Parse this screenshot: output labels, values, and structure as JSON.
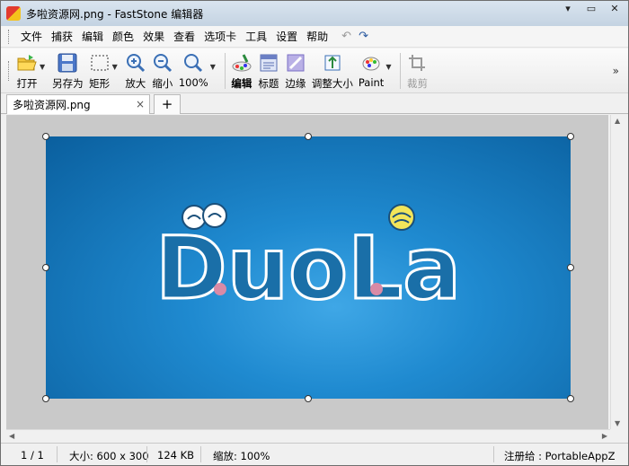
{
  "window": {
    "title": "多啦资源网.png - FastStone 编辑器",
    "minimize_glyph": "▾",
    "restore_glyph": "▭",
    "close_glyph": "✕"
  },
  "menu": {
    "items": [
      "文件",
      "捕获",
      "编辑",
      "颜色",
      "效果",
      "查看",
      "选项卡",
      "工具",
      "设置",
      "帮助"
    ],
    "undo_glyph": "↶",
    "redo_glyph": "↷"
  },
  "toolbar": {
    "open": "打开",
    "save_as": "另存为",
    "rect": "矩形",
    "zoom_in": "放大",
    "zoom_out": "缩小",
    "zoom_level": "100%",
    "edit": "编辑",
    "caption": "标题",
    "edge": "边缘",
    "resize": "调整大小",
    "paint": "Paint",
    "crop": "裁剪",
    "more_glyph": "»"
  },
  "tabs": {
    "active_label": "多啦资源网.png",
    "close_glyph": "×",
    "add_glyph": "+"
  },
  "image": {
    "logo_text": "DuoLa"
  },
  "status": {
    "page": "1 / 1",
    "size": "大小: 600 x 300",
    "file_size": "124 KB",
    "zoom": "缩放: 100%",
    "registered": "注册给 : PortableAppZ"
  },
  "colors": {
    "image_blue": "#1f8ad0",
    "logo_fill": "#1a6fa8",
    "logo_outline": "#ffffff",
    "accent_pink": "#d98aa6",
    "accent_yellow": "#f2e55a"
  }
}
